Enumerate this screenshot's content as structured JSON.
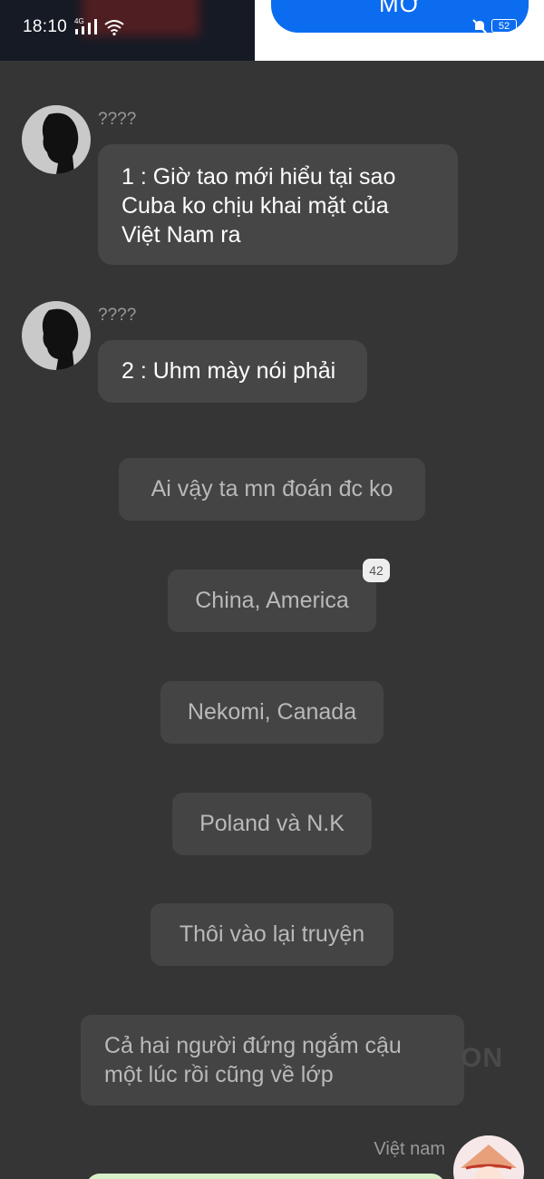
{
  "status_bar": {
    "time": "18:10",
    "network": "4G",
    "battery": "52",
    "icons": [
      "signal-icon",
      "wifi-icon",
      "mute-icon",
      "battery-icon"
    ]
  },
  "open_button": {
    "label": "MỞ"
  },
  "messages": [
    {
      "sender": "????",
      "text_lines": [
        "1 : Giờ tao mới hiểu tại sao",
        "Cuba ko chịu khai mặt của",
        "Việt Nam ra"
      ]
    },
    {
      "sender": "????",
      "text": "2 : Uhm mày nói phải"
    }
  ],
  "narrations": [
    {
      "text": "Ai vậy ta mn đoán đc ko"
    },
    {
      "text": "China, America",
      "badge": "42"
    },
    {
      "text": "Nekomi, Canada"
    },
    {
      "text": "Poland và N.K"
    },
    {
      "text": "Thôi vào lại truyện"
    },
    {
      "text_lines": [
        "Cả hai người đứng ngắm cậu",
        "một lúc rồi cũng về lớp"
      ]
    }
  ],
  "watermark": "ON",
  "right_sender": {
    "name": "Việt nam"
  },
  "colors": {
    "background": "#353535",
    "bubble": "#464646",
    "accent_button": "#0b6cf0",
    "green_bubble": "#d8f0c8"
  }
}
